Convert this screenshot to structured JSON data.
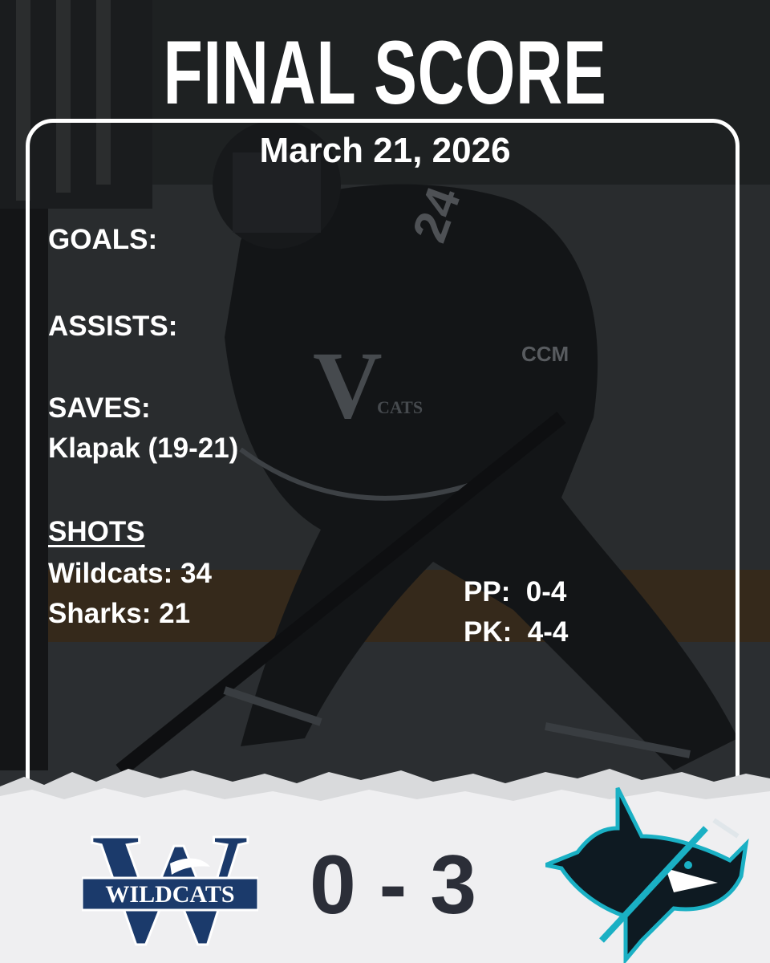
{
  "header": {
    "title": "FINAL SCORE",
    "date": "March 21, 2026"
  },
  "stats": {
    "goals_label": "GOALS:",
    "assists_label": "ASSISTS:",
    "saves_label": "SAVES:",
    "saves_value": "Klapak (19-21)",
    "shots_label": "SHOTS",
    "shots_home": "Wildcats: 34",
    "shots_away": "Sharks: 21",
    "pp": "PP:  0-4",
    "pk": "PK:  4-4"
  },
  "score": {
    "text": "0 - 3",
    "home": 0,
    "away": 3
  },
  "teams": {
    "home": {
      "name": "WILDCATS",
      "logo_letter": "W",
      "color": "#1b3a6b"
    },
    "away": {
      "name": "Sharks",
      "color": "#1ab0c4"
    }
  },
  "photo": {
    "jersey_number": "24",
    "jersey_letter": "V",
    "jersey_text": "CATS",
    "glove_text": "CCM"
  }
}
